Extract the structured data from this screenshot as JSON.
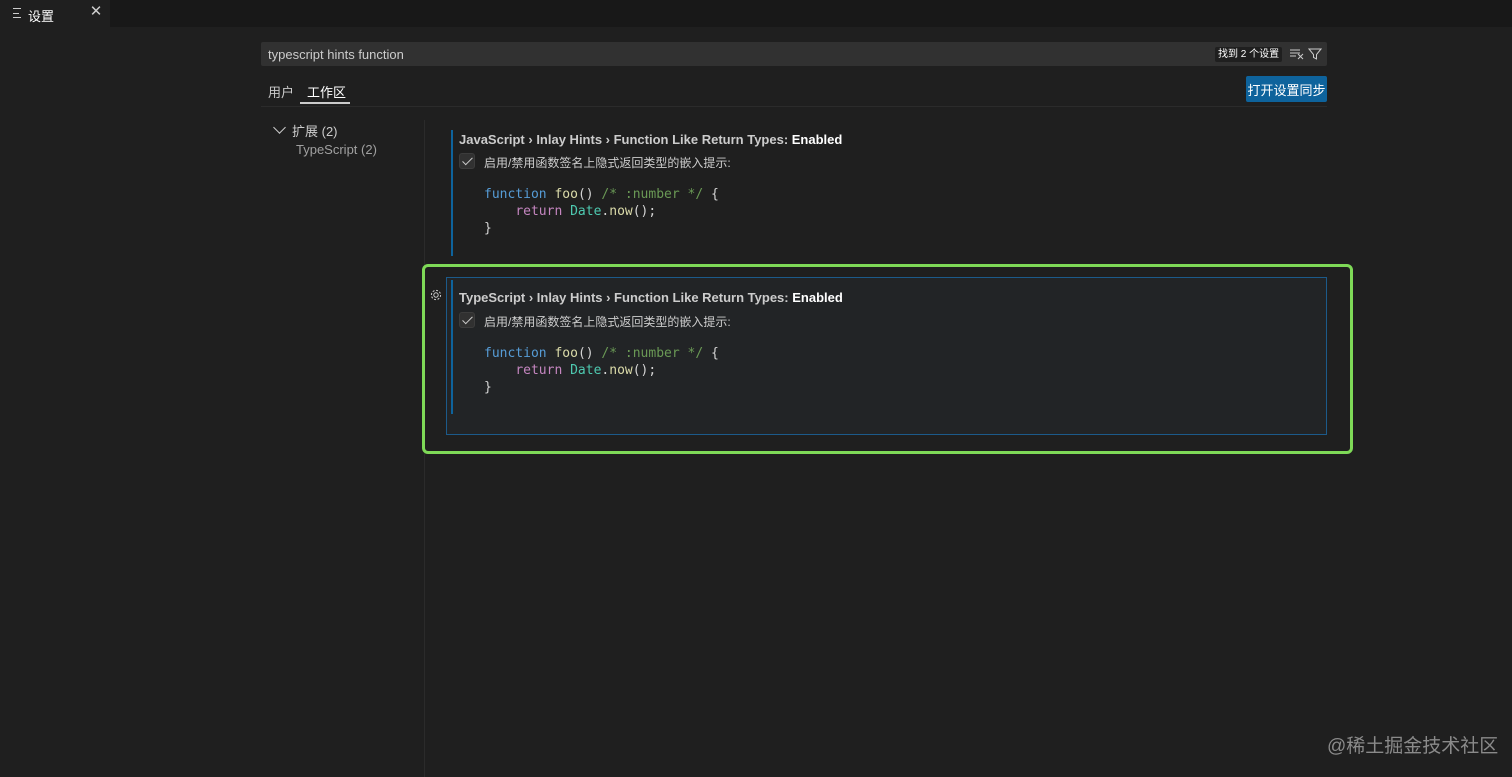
{
  "tab": {
    "title": "设置",
    "close_glyph": "✕",
    "icon": "lines-icon"
  },
  "search": {
    "value": "typescript hints function",
    "result_badge": "找到 2 个设置",
    "clear_icon": "clear-filter-icon",
    "filter_icon": "funnel-icon"
  },
  "scopes": {
    "user": "用户",
    "workspace": "工作区",
    "active": "workspace"
  },
  "sync_button": "打开设置同步",
  "toc": {
    "group_label": "扩展 (2)",
    "items": [
      {
        "label": "TypeScript (2)"
      }
    ]
  },
  "settings": [
    {
      "category": "JavaScript › Inlay Hints › Function Like Return Types: ",
      "name": "Enabled",
      "checked": true,
      "description": "启用/禁用函数签名上隐式返回类型的嵌入提示:",
      "code": {
        "l1_kw": "function",
        "l1_fn": "foo",
        "l1_paren": "()",
        "l1_cm": "/* :number */",
        "l1_brace": "{",
        "l2_kw": "return",
        "l2_ty": "Date",
        "l2_dot": ".",
        "l2_fn": "now",
        "l2_end": "();",
        "l3": "}"
      }
    },
    {
      "category": "TypeScript › Inlay Hints › Function Like Return Types: ",
      "name": "Enabled",
      "checked": true,
      "description": "启用/禁用函数签名上隐式返回类型的嵌入提示:",
      "code": {
        "l1_kw": "function",
        "l1_fn": "foo",
        "l1_paren": "()",
        "l1_cm": "/* :number */",
        "l1_brace": "{",
        "l2_kw": "return",
        "l2_ty": "Date",
        "l2_dot": ".",
        "l2_fn": "now",
        "l2_end": "();",
        "l3": "}"
      }
    }
  ],
  "watermark": "@稀土掘金技术社区",
  "colors": {
    "accent": "#0e639c",
    "highlight": "#7ed957",
    "background": "#1f1f1f"
  }
}
